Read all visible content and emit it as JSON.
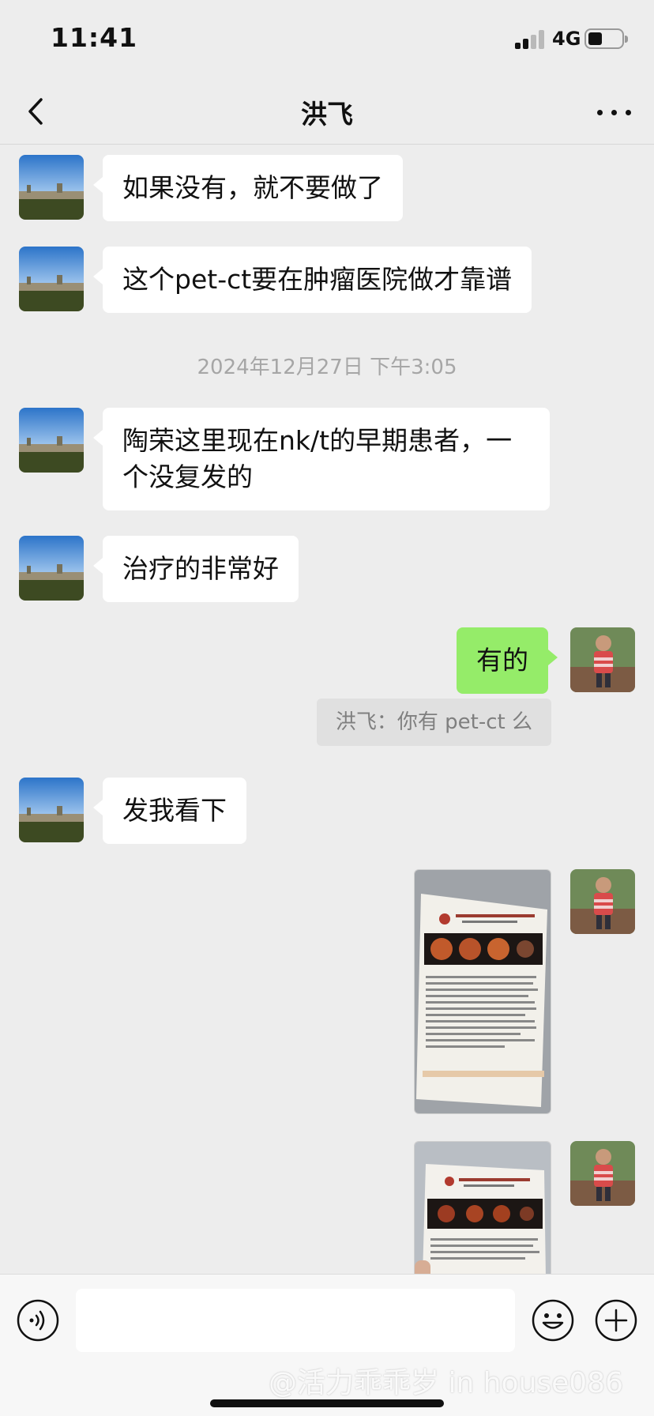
{
  "status_bar": {
    "time": "11:41",
    "network": "4G"
  },
  "nav": {
    "title": "洪飞"
  },
  "messages": [
    {
      "side": "left",
      "text": "如果没有，就不要做了"
    },
    {
      "side": "left",
      "text": "这个pet-ct要在肿瘤医院做才靠谱"
    },
    {
      "type": "timestamp",
      "text": "2024年12月27日 下午3:05"
    },
    {
      "side": "left",
      "line1": "陶荣这里现在nk/t的早期患者，一",
      "line2": "个没复发的"
    },
    {
      "side": "left",
      "text": "治疗的非常好"
    },
    {
      "side": "right",
      "text": "有的"
    },
    {
      "type": "quote",
      "text": "洪飞：你有 pet-ct 么"
    },
    {
      "side": "left",
      "text": "发我看下"
    },
    {
      "side": "right",
      "type": "image",
      "icon": "report-photo"
    },
    {
      "side": "right",
      "type": "image",
      "icon": "report-photo"
    }
  ],
  "input": {
    "placeholder": ""
  },
  "watermark": "@活力乖乖岁 in house086",
  "colors": {
    "background": "#ededed",
    "bubble_self": "#95ec69",
    "bubble_other": "#ffffff"
  }
}
